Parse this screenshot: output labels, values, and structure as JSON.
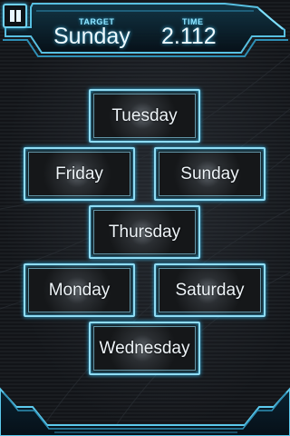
{
  "hud": {
    "pause_icon": "pause-icon",
    "target_label": "TARGET",
    "target_value": "Sunday",
    "time_label": "TIME",
    "time_value": "2.112"
  },
  "days": [
    {
      "label": "Tuesday"
    },
    {
      "label": "Friday"
    },
    {
      "label": "Sunday"
    },
    {
      "label": "Thursday"
    },
    {
      "label": "Monday"
    },
    {
      "label": "Saturday"
    },
    {
      "label": "Wednesday"
    }
  ],
  "colors": {
    "accent": "#8fdcf4",
    "accent_glow": "#2fa8d8",
    "text": "#eef4f8",
    "background": "#121418"
  }
}
